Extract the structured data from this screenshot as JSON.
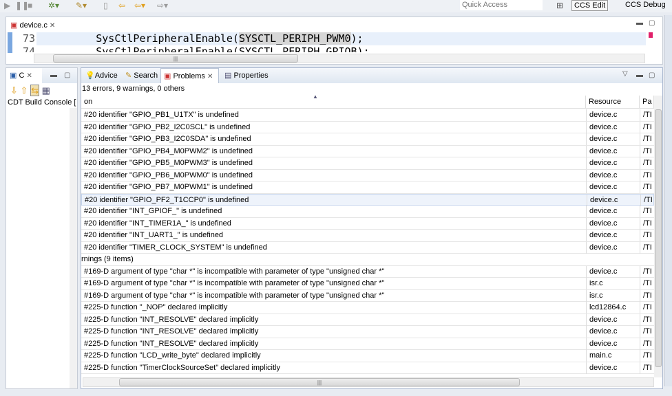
{
  "toolbar": {
    "quick_access": "Quick Access",
    "perspectives": [
      {
        "label": "CCS Edit"
      },
      {
        "label": "CCS Debug"
      }
    ]
  },
  "editor": {
    "tab": "device.c",
    "lines": [
      {
        "num": "73",
        "pre": "        SysCtlPeripheralEnable(",
        "mark": "SYSCTL_PERIPH_PWM0",
        "post": ");"
      },
      {
        "num": "74",
        "pre": "        SysCtlPeripheralEnable(SYSCTL_PERIPH_GPIOB);",
        "mark": "",
        "post": ""
      }
    ]
  },
  "left_panel": {
    "tab": "C",
    "console": "CDT Build Console ["
  },
  "problems": {
    "tabs": [
      {
        "label": "Advice"
      },
      {
        "label": "Search"
      },
      {
        "label": "Problems"
      },
      {
        "label": "Properties"
      }
    ],
    "summary": "13 errors, 9 warnings, 0 others",
    "columns": [
      "on",
      "Resource",
      "Pa"
    ],
    "rows": [
      [
        "#20 identifier \"GPIO_PB1_U1TX\" is undefined",
        "device.c",
        "/TI"
      ],
      [
        "#20 identifier \"GPIO_PB2_I2C0SCL\" is undefined",
        "device.c",
        "/TI"
      ],
      [
        "#20 identifier \"GPIO_PB3_I2C0SDA\" is undefined",
        "device.c",
        "/TI"
      ],
      [
        "#20 identifier \"GPIO_PB4_M0PWM2\" is undefined",
        "device.c",
        "/TI"
      ],
      [
        "#20 identifier \"GPIO_PB5_M0PWM3\" is undefined",
        "device.c",
        "/TI"
      ],
      [
        "#20 identifier \"GPIO_PB6_M0PWM0\" is undefined",
        "device.c",
        "/TI"
      ],
      [
        "#20 identifier \"GPIO_PB7_M0PWM1\" is undefined",
        "device.c",
        "/TI"
      ],
      [
        "#20 identifier \"GPIO_PF2_T1CCP0\" is undefined",
        "device.c",
        "/TI"
      ],
      [
        "#20 identifier \"INT_GPIOF_\" is undefined",
        "device.c",
        "/TI"
      ],
      [
        "#20 identifier \"INT_TIMER1A_\" is undefined",
        "device.c",
        "/TI"
      ],
      [
        "#20 identifier \"INT_UART1_\" is undefined",
        "device.c",
        "/TI"
      ],
      [
        "#20 identifier \"TIMER_CLOCK_SYSTEM\" is undefined",
        "device.c",
        "/TI"
      ],
      [
        "rnings (9 items)",
        "",
        ""
      ],
      [
        "#169-D argument of type \"char *\" is incompatible with parameter of type \"unsigned char *\"",
        "device.c",
        "/TI"
      ],
      [
        "#169-D argument of type \"char *\" is incompatible with parameter of type \"unsigned char *\"",
        "isr.c",
        "/TI"
      ],
      [
        "#169-D argument of type \"char *\" is incompatible with parameter of type \"unsigned char *\"",
        "isr.c",
        "/TI"
      ],
      [
        "#225-D function \"_NOP\" declared implicitly",
        "lcd12864.c",
        "/TI"
      ],
      [
        "#225-D function \"INT_RESOLVE\" declared implicitly",
        "device.c",
        "/TI"
      ],
      [
        "#225-D function \"INT_RESOLVE\" declared implicitly",
        "device.c",
        "/TI"
      ],
      [
        "#225-D function \"INT_RESOLVE\" declared implicitly",
        "device.c",
        "/TI"
      ],
      [
        "#225-D function \"LCD_write_byte\" declared implicitly",
        "main.c",
        "/TI"
      ],
      [
        "#225-D function \"TimerClockSourceSet\" declared implicitly",
        "device.c",
        "/TI"
      ]
    ],
    "selected_row": 7
  }
}
